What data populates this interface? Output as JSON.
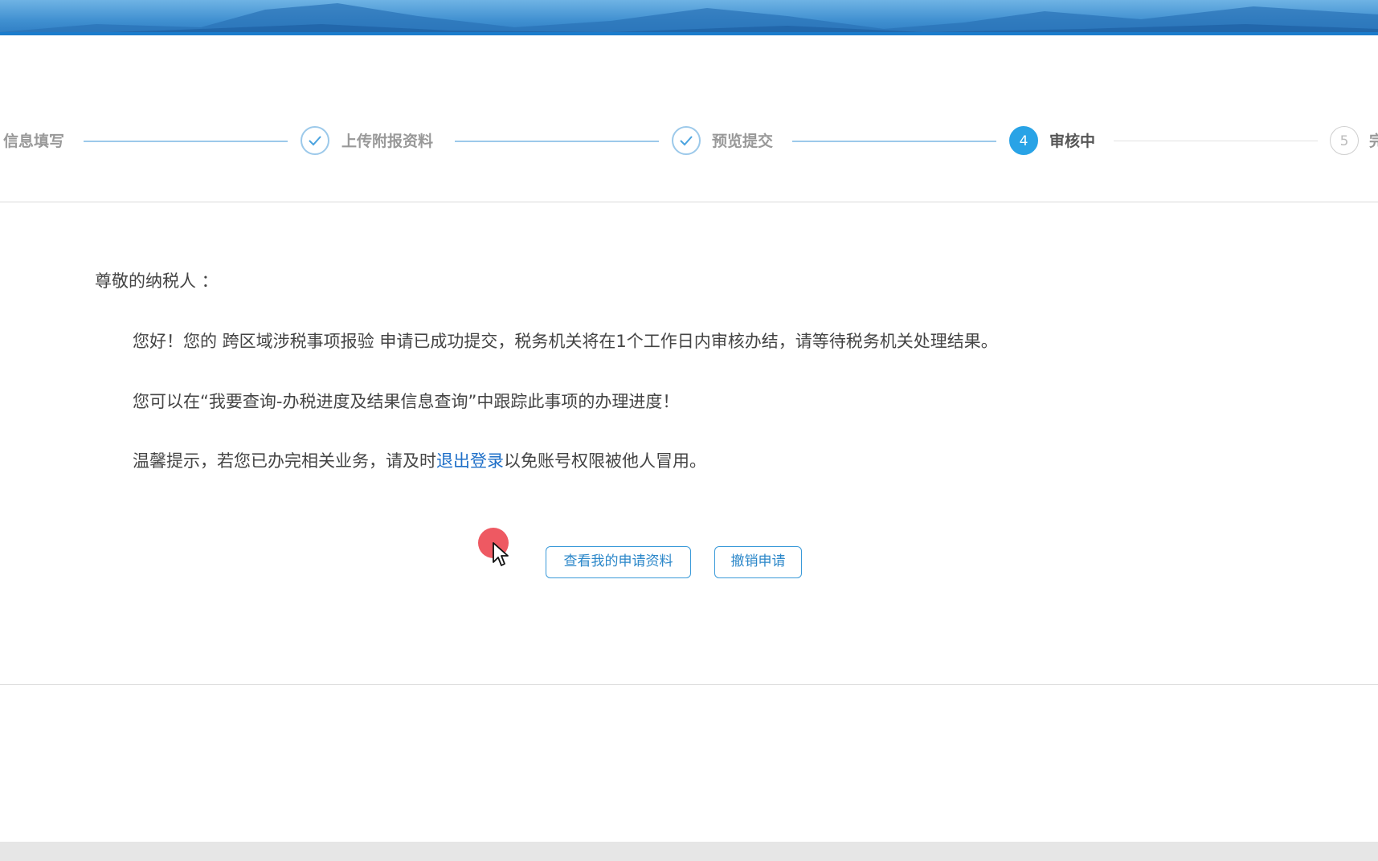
{
  "steps": [
    {
      "label": "信息填写",
      "state": "done"
    },
    {
      "label": "上传附报资料",
      "state": "done"
    },
    {
      "label": "预览提交",
      "state": "done"
    },
    {
      "label": "审核中",
      "number": "4",
      "state": "active"
    },
    {
      "label": "完",
      "number": "5",
      "state": "todo"
    }
  ],
  "message": {
    "salutation": "尊敬的纳税人 ：",
    "line1": "您好！您的 跨区域涉税事项报验 申请已成功提交，税务机关将在1个工作日内审核办结，请等待税务机关处理结果。",
    "line2": "您可以在“我要查询-办税进度及结果信息查询”中跟踪此事项的办理进度！",
    "line3_prefix": "温馨提示，若您已办完相关业务，请及时",
    "line3_link": "退出登录",
    "line3_suffix": "以免账号权限被他人冒用。"
  },
  "buttons": {
    "view": "查看我的申请资料",
    "cancel": "撤销申请"
  },
  "colors": {
    "accent": "#29a3e6",
    "link": "#1e6fc8",
    "done_line": "#9cc9ea"
  }
}
